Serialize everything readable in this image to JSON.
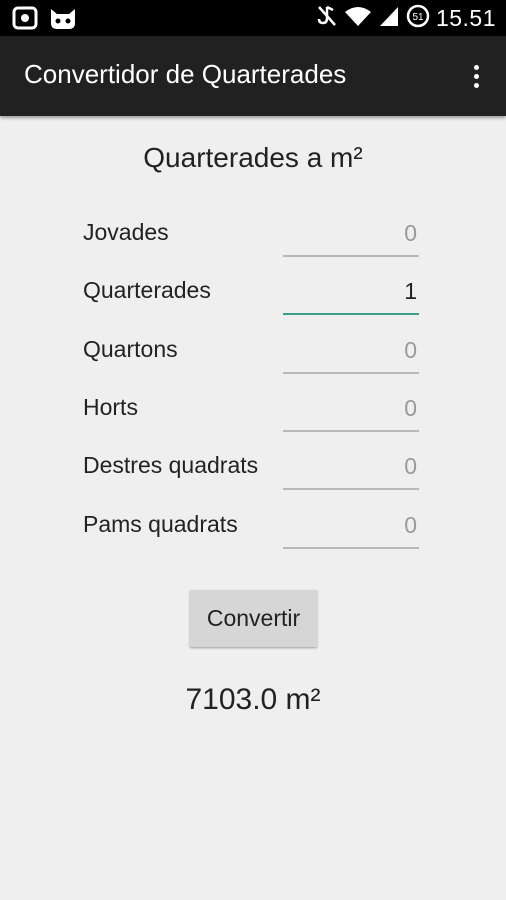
{
  "status_bar": {
    "time": "15.51",
    "left_icons": [
      "camera-icon",
      "cat-face-icon"
    ],
    "right_icons": [
      "mute-icon",
      "wifi-icon",
      "signal-icon",
      "battery-icon"
    ],
    "battery_level": "51"
  },
  "action_bar": {
    "title": "Convertidor de Quarterades",
    "overflow_icon": "overflow-menu-icon"
  },
  "main": {
    "section_title": "Quarterades a m²",
    "rows": [
      {
        "label": "Jovades",
        "value": "0"
      },
      {
        "label": "Quarterades",
        "value": "1"
      },
      {
        "label": "Quartons",
        "value": "0"
      },
      {
        "label": "Horts",
        "value": "0"
      },
      {
        "label": "Destres quadrats",
        "value": "0"
      },
      {
        "label": "Pams quadrats",
        "value": "0"
      }
    ],
    "convert_label": "Convertir",
    "result": "7103.0 m²"
  },
  "colors": {
    "status_bar": "#000000",
    "action_bar": "#212121",
    "background": "#efefef",
    "focused_underline": "#3a9c8e"
  }
}
